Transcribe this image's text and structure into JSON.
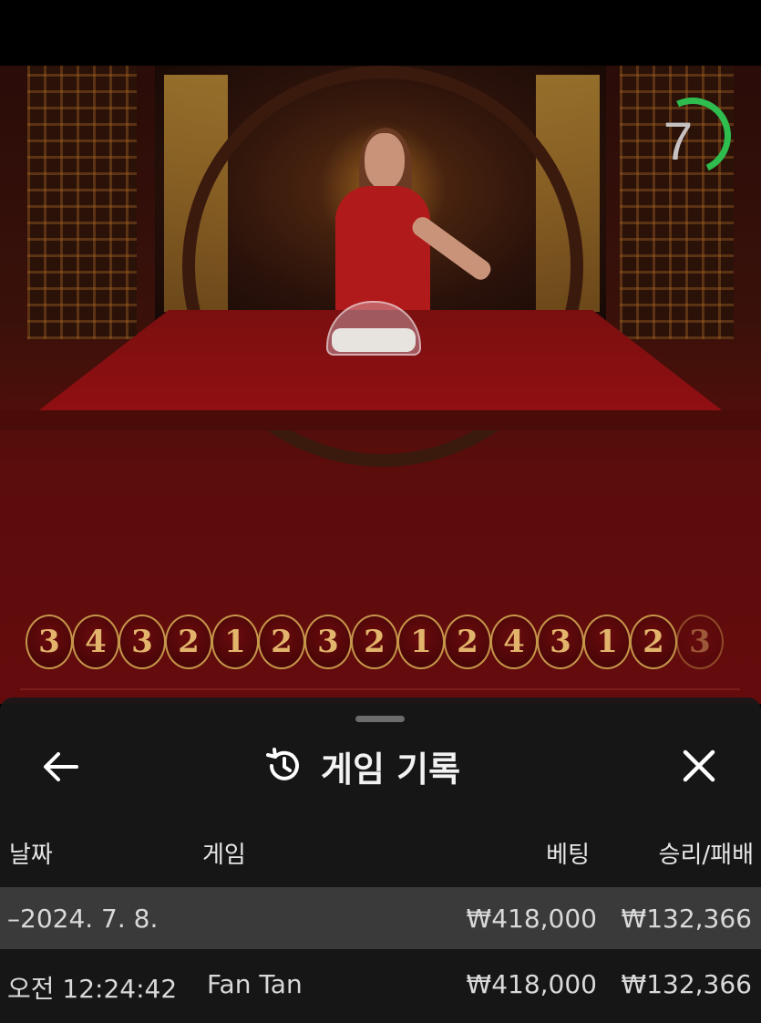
{
  "timer": {
    "seconds": "7",
    "color": "#2ebd4e"
  },
  "road": {
    "results": [
      "3",
      "4",
      "3",
      "2",
      "1",
      "2",
      "3",
      "2",
      "1",
      "2",
      "4",
      "3",
      "1",
      "2",
      "3"
    ]
  },
  "history_sheet": {
    "title": "게임 기록",
    "icons": {
      "back": "arrow-left-icon",
      "history": "history-clock-icon",
      "close": "close-icon"
    },
    "columns": {
      "date": "날짜",
      "game": "게임",
      "bet": "베팅",
      "win_loss": "승리/패배"
    },
    "date_group": {
      "label": "–2024. 7. 8.",
      "bet": "₩418,000",
      "win_loss": "₩132,366"
    },
    "rows": [
      {
        "time": "오전 12:24:42",
        "game": "Fan Tan",
        "bet": "₩418,000",
        "win_loss": "₩132,366"
      }
    ]
  }
}
